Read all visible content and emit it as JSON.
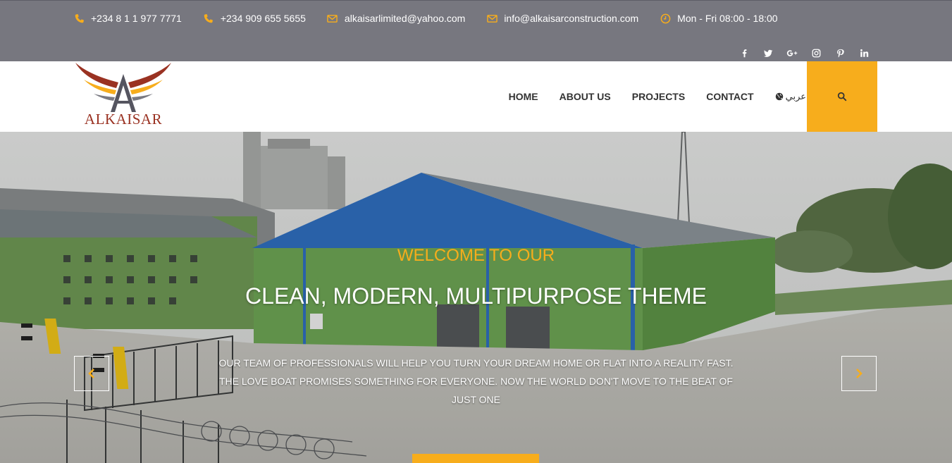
{
  "topbar": {
    "contacts": [
      {
        "icon": "phone-icon",
        "text": "+234 8 1 1 977 7771"
      },
      {
        "icon": "phone-icon",
        "text": "+234 909 655 5655"
      },
      {
        "icon": "mail-icon",
        "text": "alkaisarlimited@yahoo.com"
      },
      {
        "icon": "mail-icon",
        "text": "info@alkaisarconstruction.com"
      },
      {
        "icon": "clock-icon",
        "text": "Mon - Fri 08:00 - 18:00"
      }
    ],
    "social": [
      "facebook-icon",
      "twitter-icon",
      "google-plus-icon",
      "instagram-icon",
      "pinterest-icon",
      "linkedin-icon"
    ],
    "icon_color": "#f7ad1c"
  },
  "logo": {
    "text": "ALKAISAR"
  },
  "nav": {
    "items": [
      "HOME",
      "ABOUT US",
      "PROJECTS",
      "CONTACT"
    ],
    "language": "عربي"
  },
  "hero": {
    "kicker": "WELCOME TO OUR",
    "headline": "CLEAN, MODERN, MULTIPURPOSE THEME",
    "description": "OUR TEAM OF PROFESSIONALS WILL HELP YOU TURN YOUR DREAM HOME OR FLAT INTO A REALITY FAST. THE LOVE BOAT PROMISES SOMETHING FOR EVERYONE. NOW THE WORLD DON'T MOVE TO THE BEAT OF JUST ONE"
  },
  "colors": {
    "accent": "#f7ad1c",
    "topbar": "#77777f"
  }
}
